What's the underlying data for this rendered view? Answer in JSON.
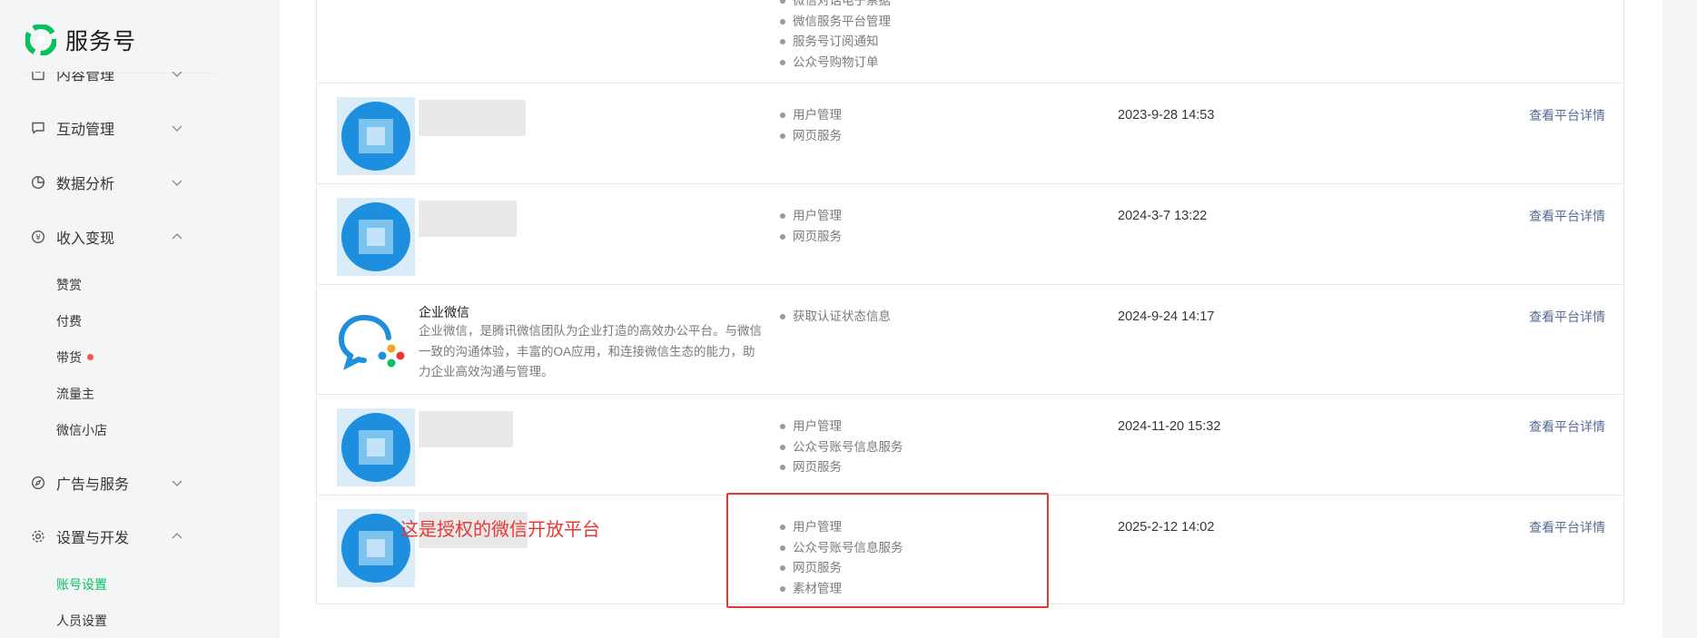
{
  "app": {
    "title": "服务号",
    "brand_color": "#07c160"
  },
  "sidebar": {
    "groups": [
      {
        "label": "内容管理",
        "icon": "doc-icon",
        "expanded": false
      },
      {
        "label": "互动管理",
        "icon": "chat-icon",
        "expanded": false
      },
      {
        "label": "数据分析",
        "icon": "pie-icon",
        "expanded": false
      },
      {
        "label": "收入变现",
        "icon": "yen-icon",
        "expanded": true
      },
      {
        "label": "广告与服务",
        "icon": "compass-icon",
        "expanded": false
      },
      {
        "label": "设置与开发",
        "icon": "gear-icon",
        "expanded": true
      }
    ],
    "income_items": [
      "赞赏",
      "付费",
      "带货",
      "流量主",
      "微信小店"
    ],
    "settings_items": [
      "账号设置",
      "人员设置"
    ],
    "active_item": "账号设置"
  },
  "table": {
    "link_label": "查看平台详情",
    "rows": [
      {
        "perms": [
          "微信对话电子票据",
          "微信服务平台管理",
          "服务号订阅通知",
          "公众号购物订单"
        ],
        "time": "",
        "link": ""
      },
      {
        "perms": [
          "用户管理",
          "网页服务"
        ],
        "time": "2023-9-28 14:53",
        "link": "查看平台详情"
      },
      {
        "perms": [
          "用户管理",
          "网页服务"
        ],
        "time": "2024-3-7 13:22",
        "link": "查看平台详情"
      },
      {
        "title": "企业微信",
        "desc": "企业微信，是腾讯微信团队为企业打造的高效办公平台。与微信一致的沟通体验，丰富的OA应用，和连接微信生态的能力，助力企业高效沟通与管理。",
        "perms": [
          "获取认证状态信息"
        ],
        "time": "2024-9-24 14:17",
        "link": "查看平台详情"
      },
      {
        "perms": [
          "用户管理",
          "公众号账号信息服务",
          "网页服务"
        ],
        "time": "2024-11-20 15:32",
        "link": "查看平台详情"
      },
      {
        "perms": [
          "用户管理",
          "公众号账号信息服务",
          "网页服务",
          "素材管理"
        ],
        "time": "2025-2-12 14:02",
        "link": "查看平台详情"
      }
    ]
  },
  "annotation": {
    "text": "这是授权的微信开放平台",
    "color": "#e53935"
  }
}
